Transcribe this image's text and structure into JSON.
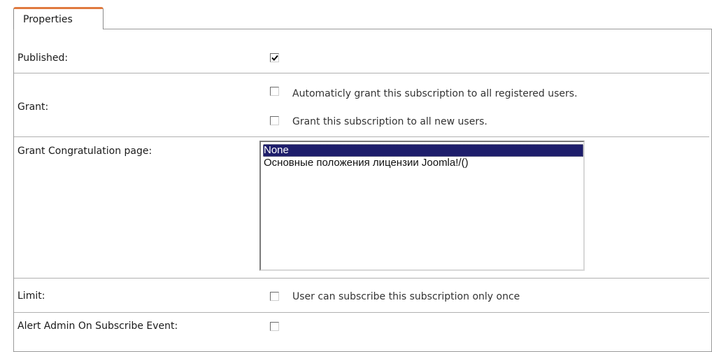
{
  "tab": {
    "label": "Properties"
  },
  "fields": {
    "published": {
      "label": "Published:",
      "checked": true
    },
    "grant": {
      "label": "Grant:",
      "options": [
        {
          "text": "Automaticly grant this subscription to all registered users.",
          "checked": false
        },
        {
          "text": "Grant this subscription to all new users.",
          "checked": false
        }
      ]
    },
    "congrat": {
      "label": "Grant Congratulation page:",
      "options": [
        {
          "text": "None",
          "selected": true
        },
        {
          "text": "Основные положения лицензии Joomla!/()",
          "selected": false
        }
      ]
    },
    "limit": {
      "label": "Limit:",
      "text": "User can subscribe this subscription only once",
      "checked": false
    },
    "alert": {
      "label": "Alert Admin On Subscribe Event:",
      "checked": false
    }
  },
  "colors": {
    "tab_accent": "#e07a3f",
    "selection_bg": "#1d1d6b"
  }
}
